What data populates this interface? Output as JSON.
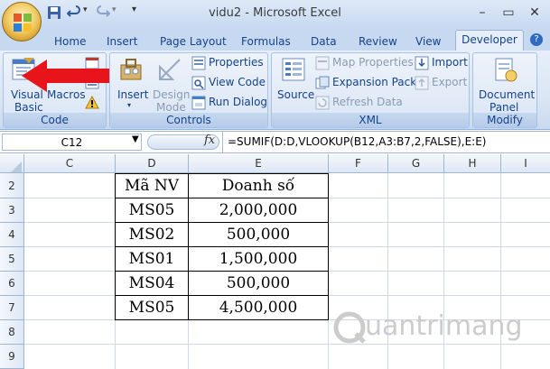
{
  "window": {
    "title": "vidu2 - Microsoft Excel"
  },
  "tabs": [
    "Home",
    "Insert",
    "Page Layout",
    "Formulas",
    "Data",
    "Review",
    "View",
    "Developer"
  ],
  "ribbon": {
    "code": {
      "label": "Code",
      "visual_basic": [
        "Visual",
        "Basic"
      ],
      "macros": "Macros"
    },
    "controls": {
      "label": "Controls",
      "insert": "Insert",
      "design_mode": [
        "Design",
        "Mode"
      ],
      "properties": "Properties",
      "view_code": "View Code",
      "run_dialog": "Run Dialog"
    },
    "xml": {
      "label": "XML",
      "source": "Source",
      "map_properties": "Map Properties",
      "expansion_packs": "Expansion Packs",
      "refresh_data": "Refresh Data",
      "import": "Import",
      "export": "Export"
    },
    "modify": {
      "label": "Modify",
      "document_panel": [
        "Document",
        "Panel"
      ]
    }
  },
  "formula_bar": {
    "name_box": "C12",
    "fx": "fx",
    "formula": "=SUMIF(D:D,VLOOKUP(B12,A3:B7,2,FALSE),E:E)"
  },
  "columns": [
    "C",
    "D",
    "E",
    "F",
    "G",
    "H",
    "I"
  ],
  "rows": [
    "2",
    "3",
    "4",
    "5",
    "6",
    "7",
    "8",
    "9"
  ],
  "table": {
    "headers": [
      "Mã NV",
      "Doanh số"
    ],
    "rows": [
      [
        "MS05",
        "2,000,000"
      ],
      [
        "MS02",
        "500,000"
      ],
      [
        "MS01",
        "1,500,000"
      ],
      [
        "MS04",
        "500,000"
      ],
      [
        "MS05",
        "4,500,000"
      ]
    ]
  },
  "watermark": "uantrimang",
  "colors": {
    "arrow": "#e8141b",
    "ribbon_text": "#15428b"
  }
}
